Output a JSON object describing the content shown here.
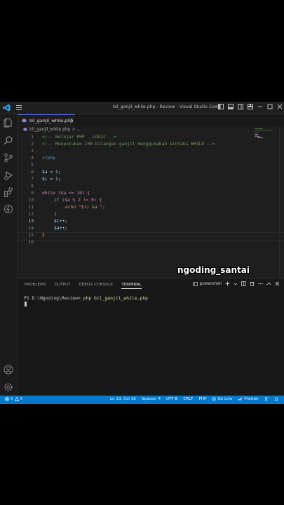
{
  "window": {
    "title": "bil_ganjil_while.php - Review - Visual Studio Code"
  },
  "tab": {
    "filename": "bil_ganjil_while.php",
    "close": "×"
  },
  "breadcrumb": {
    "file": "bil_ganjil_while.php",
    "rest": "> ..."
  },
  "code_lines": [
    {
      "n": "1",
      "text": "<!-- Belajar PHP - LOGIC -->"
    },
    {
      "n": "2",
      "text": "<!-- Menentukan 100 bilangan ganjil menggunakan sintaks WHILE -->"
    },
    {
      "n": "3",
      "text": ""
    },
    {
      "n": "4",
      "text": "<?php"
    },
    {
      "n": "5",
      "text": ""
    },
    {
      "n": "6",
      "text": "$a = 1;"
    },
    {
      "n": "7",
      "text": "$i = 1;"
    },
    {
      "n": "8",
      "text": ""
    },
    {
      "n": "9",
      "text": "while ($a <= 10) {"
    },
    {
      "n": "10",
      "text": "if ($a % 2 != 0) {"
    },
    {
      "n": "11",
      "text": "echo \"$i) $a \";"
    },
    {
      "n": "12",
      "text": "}"
    },
    {
      "n": "13",
      "text": "$i++;"
    },
    {
      "n": "14",
      "text": "$a++;"
    },
    {
      "n": "15",
      "text": "}"
    },
    {
      "n": "16",
      "text": ""
    }
  ],
  "watermark": "ngoding_santai",
  "panel": {
    "tabs": [
      "PROBLEMS",
      "OUTPUT",
      "DEBUG CONSOLE",
      "TERMINAL"
    ],
    "shell": "powershell",
    "prompt": "PS D:\\Ngoding\\Review>",
    "command": "php bil_ganjil_while.php"
  },
  "status": {
    "errors": "0",
    "warnings": "0",
    "position": "Ln 13, Col 10",
    "spaces": "Spaces: 4",
    "encoding": "UTF-8",
    "eol": "CRLF",
    "language": "PHP",
    "golive": "Go Live",
    "prettier": "Prettier"
  },
  "colors": {
    "statusbar": "#007acc",
    "editor_bg": "#1e1e1e",
    "comment": "#6a9955",
    "keyword": "#c586c0",
    "variable": "#9cdcfe"
  },
  "icons": [
    "vscode-logo-icon",
    "menu-icon",
    "explorer-icon",
    "search-icon",
    "source-control-icon",
    "run-debug-icon",
    "extensions-icon",
    "remote-icon",
    "account-icon",
    "settings-gear-icon",
    "php-file-icon"
  ]
}
